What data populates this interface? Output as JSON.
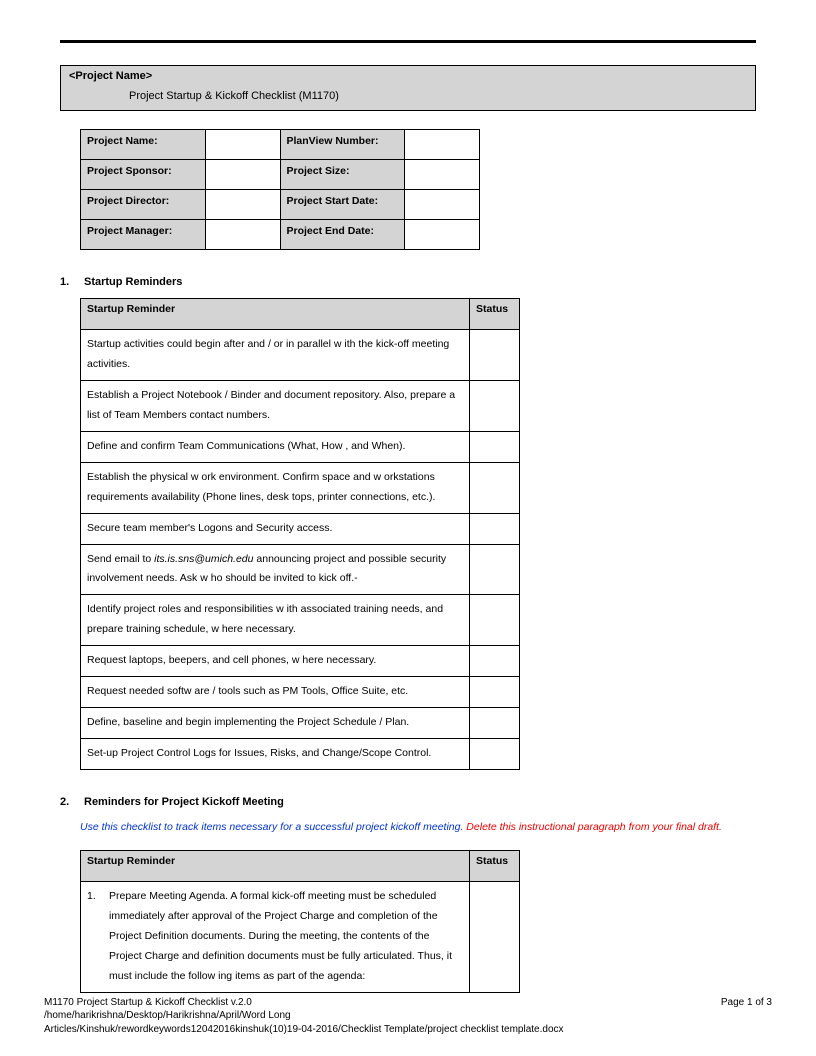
{
  "header": {
    "project_name_placeholder": "<Project Name>",
    "doc_title": "Project Startup & Kickoff Checklist (M1170)"
  },
  "meta_labels": {
    "project_name": "Project Name:",
    "planview": "PlanView Number:",
    "sponsor": "Project Sponsor:",
    "size": "Project Size:",
    "director": "Project Director:",
    "start": "Project Start Date:",
    "manager": "Project Manager:",
    "end": "Project End Date:"
  },
  "section1": {
    "num": "1.",
    "title": "Startup Reminders",
    "col_reminder": "Startup Reminder",
    "col_status": "Status",
    "rows": [
      "Startup activities could begin after and / or in parallel w ith the kick-off meeting activities.",
      "Establish a Project Notebook / Binder and document repository. Also, prepare a list of Team Members contact numbers.",
      "Define and confirm Team Communications (What, How , and When).",
      "Establish the physical w ork environment. Confirm space and w orkstations requirements availability (Phone lines, desk tops, printer connections, etc.).",
      "Secure team member's Logons and Security access.",
      "",
      "Identify project roles and responsibilities w ith associated training needs, and prepare training schedule, w here necessary.",
      "Request laptops, beepers, and cell phones, w here necessary.",
      "Request needed softw are / tools such as PM Tools, Office Suite, etc.",
      "Define, baseline and begin implementing the Project Schedule / Plan.",
      "Set-up Project Control Logs for Issues, Risks, and Change/Scope Control."
    ],
    "row6_pre": "Send email to ",
    "row6_email": "its.is.sns@umich.edu",
    "row6_post": " announcing project and possible security involvement needs.  Ask w ho should be invited to kick off.-"
  },
  "section2": {
    "num": "2.",
    "title": "Reminders for Project Kickoff Meeting",
    "instr_blue": "Use this checklist to track items necessary for a successful project kickoff meeting.",
    "instr_red": " Delete this instructional paragraph from your final draft.",
    "col_reminder": "Startup Reminder",
    "col_status": "Status",
    "row1_num": "1.",
    "row1_text": "Prepare Meeting Agenda. A formal kick-off meeting must be scheduled immediately after approval of the Project Charge and completion of the Project Definition documents. During the meeting, the contents of the Project Charge and definition documents must be fully articulated. Thus, it must include the follow ing items as part of the agenda:"
  },
  "footer": {
    "line1_left": "M1170 Project Startup & Kickoff Checklist v.2.0",
    "line1_right": "Page 1 of 3",
    "line2": "/home/harikrishna/Desktop/Harikrishna/April/Word Long",
    "line3": "Articles/Kinshuk/rewordkeywords12042016kinshuk(10)19-04-2016/Checklist Template/project checklist template.docx"
  }
}
